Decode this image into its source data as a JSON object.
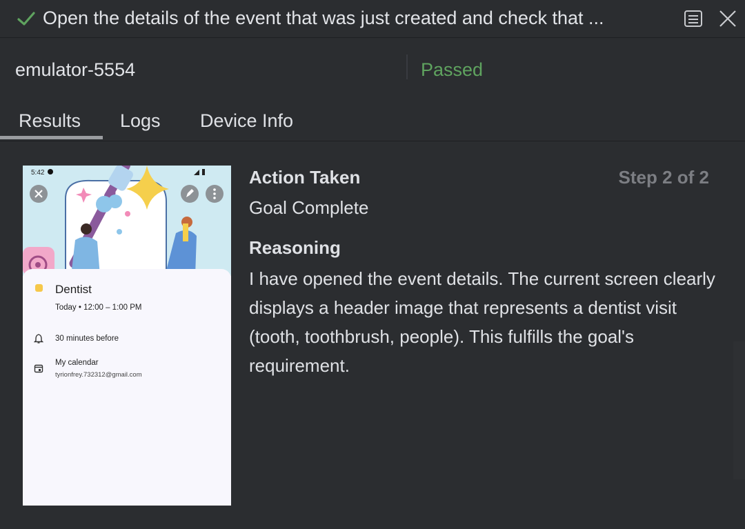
{
  "header": {
    "title": "Open the details of the event that was just created and check that ...",
    "status_icon": "check-icon",
    "accent": "#5fa35f"
  },
  "device": {
    "name": "emulator-5554",
    "status": "Passed"
  },
  "tabs": [
    {
      "label": "Results",
      "active": true
    },
    {
      "label": "Logs",
      "active": false
    },
    {
      "label": "Device Info",
      "active": false
    }
  ],
  "screenshot": {
    "status_time": "5:42",
    "event_title": "Dentist",
    "event_when": "Today  •  12:00 – 1:00 PM",
    "reminder": "30 minutes before",
    "calendar_name": "My calendar",
    "calendar_account": "tyrionfrey.732312@gmail.com"
  },
  "result": {
    "action_heading": "Action Taken",
    "step": "Step 2 of 2",
    "action_value": "Goal Complete",
    "reasoning_heading": "Reasoning",
    "reasoning_text": "I have opened the event details. The current screen clearly displays a header image that represents a dentist visit (tooth, toothbrush, people). This fulfills the goal's requirement."
  }
}
